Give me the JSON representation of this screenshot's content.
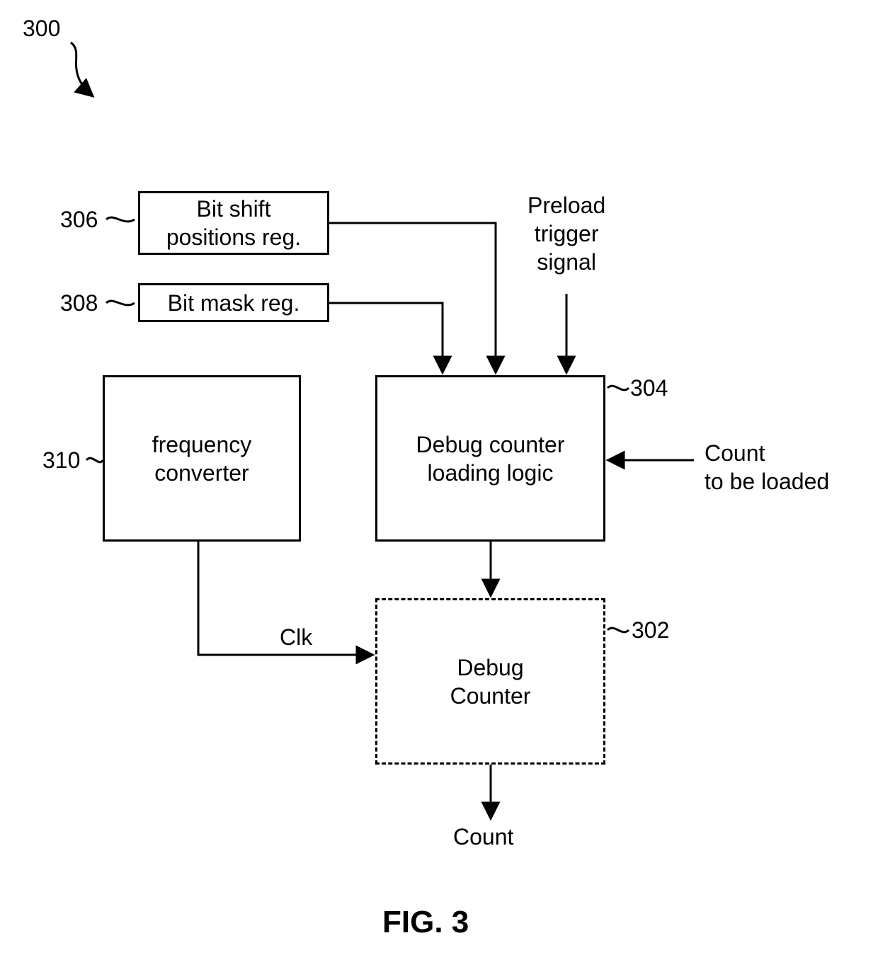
{
  "figure": {
    "number_label": "300",
    "title": "FIG.  3"
  },
  "blocks": {
    "bit_shift_reg": {
      "ref": "306",
      "text": "Bit shift\npositions reg."
    },
    "bit_mask_reg": {
      "ref": "308",
      "text": "Bit mask reg."
    },
    "freq_conv": {
      "ref": "310",
      "text": "frequency\nconverter"
    },
    "load_logic": {
      "ref": "304",
      "text": "Debug counter\nloading logic"
    },
    "debug_counter": {
      "ref": "302",
      "text": "Debug\nCounter"
    }
  },
  "signals": {
    "preload": "Preload\ntrigger\nsignal",
    "count_in": "Count\nto be loaded",
    "clk": "Clk",
    "count_out": "Count"
  }
}
